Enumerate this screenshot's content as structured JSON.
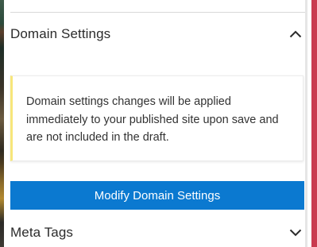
{
  "sections": {
    "domain": {
      "title": "Domain Settings",
      "expanded": true,
      "icon": "chevron-up-icon",
      "notice": "Domain settings changes will be applied immediately to your published site upon save and are not included in the draft.",
      "notice_accent": "#f7e67a",
      "button_label": "Modify Domain Settings",
      "button_color": "#0b79d0"
    },
    "meta": {
      "title": "Meta Tags",
      "expanded": false,
      "icon": "chevron-down-icon"
    }
  },
  "colors": {
    "edge_accent": "#c93a4f"
  }
}
